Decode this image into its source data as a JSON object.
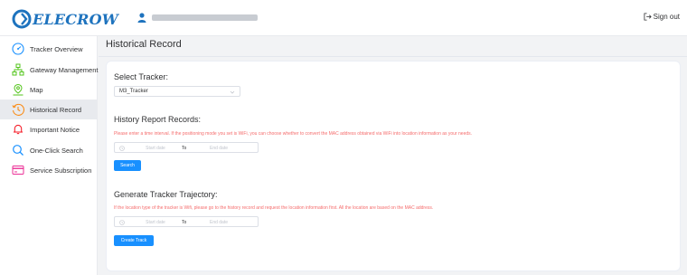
{
  "header": {
    "brand": "ELECROW",
    "user_name": "████ ███████████ ██",
    "signout_label": "Sign out"
  },
  "sidebar": {
    "items": [
      {
        "label": "Tracker Overview",
        "icon": "speedometer-icon",
        "active": false
      },
      {
        "label": "Gateway Management",
        "icon": "network-icon",
        "active": false
      },
      {
        "label": "Map",
        "icon": "map-pin-icon",
        "active": false
      },
      {
        "label": "Historical Record",
        "icon": "history-icon",
        "active": true
      },
      {
        "label": "Important Notice",
        "icon": "bell-icon",
        "active": false
      },
      {
        "label": "One-Click Search",
        "icon": "search-icon",
        "active": false
      },
      {
        "label": "Service Subscription",
        "icon": "card-icon",
        "active": false
      }
    ]
  },
  "main": {
    "page_title": "Historical Record",
    "select_tracker": {
      "title": "Select Tracker:",
      "value": "M3_Tracker"
    },
    "history_report": {
      "title": "History Report Records:",
      "hint": "Please enter a time interval. If the positioning mode you set is WiFi, you can choose whether to convert the MAC address obtained via WiFi into location information as your needs.",
      "start_placeholder": "Start date",
      "separator": "To",
      "end_placeholder": "End date",
      "button_label": "Search"
    },
    "trajectory": {
      "title": "Generate Tracker Trajectory:",
      "hint": "If the location type of the tracker is Wifi, please go to the history record and request the location information first. All the location are based on the MAC address.",
      "start_placeholder": "Start date",
      "separator": "To",
      "end_placeholder": "End date",
      "button_label": "Create Track"
    }
  },
  "colors": {
    "brand": "#1e73be",
    "primary": "#1890ff",
    "hint": "#f56c6c",
    "active_nav": "#e8eaee"
  }
}
